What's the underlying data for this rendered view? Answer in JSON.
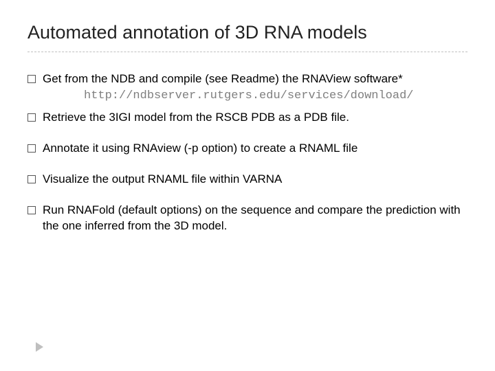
{
  "title": "Automated annotation of 3D RNA models",
  "bullets": {
    "b1": "Get from the NDB and compile (see Readme) the RNAView software*",
    "b1_url": "http://ndbserver.rutgers.edu/services/download/",
    "b2": "Retrieve the 3IGI model from the RSCB PDB as a PDB file.",
    "b3": "Annotate it using RNAview (-p option) to create a RNAML file",
    "b4": "Visualize the output RNAML file within VARNA",
    "b5": "Run RNAFold (default options) on the sequence and compare the prediction with the one inferred from the 3D model."
  }
}
